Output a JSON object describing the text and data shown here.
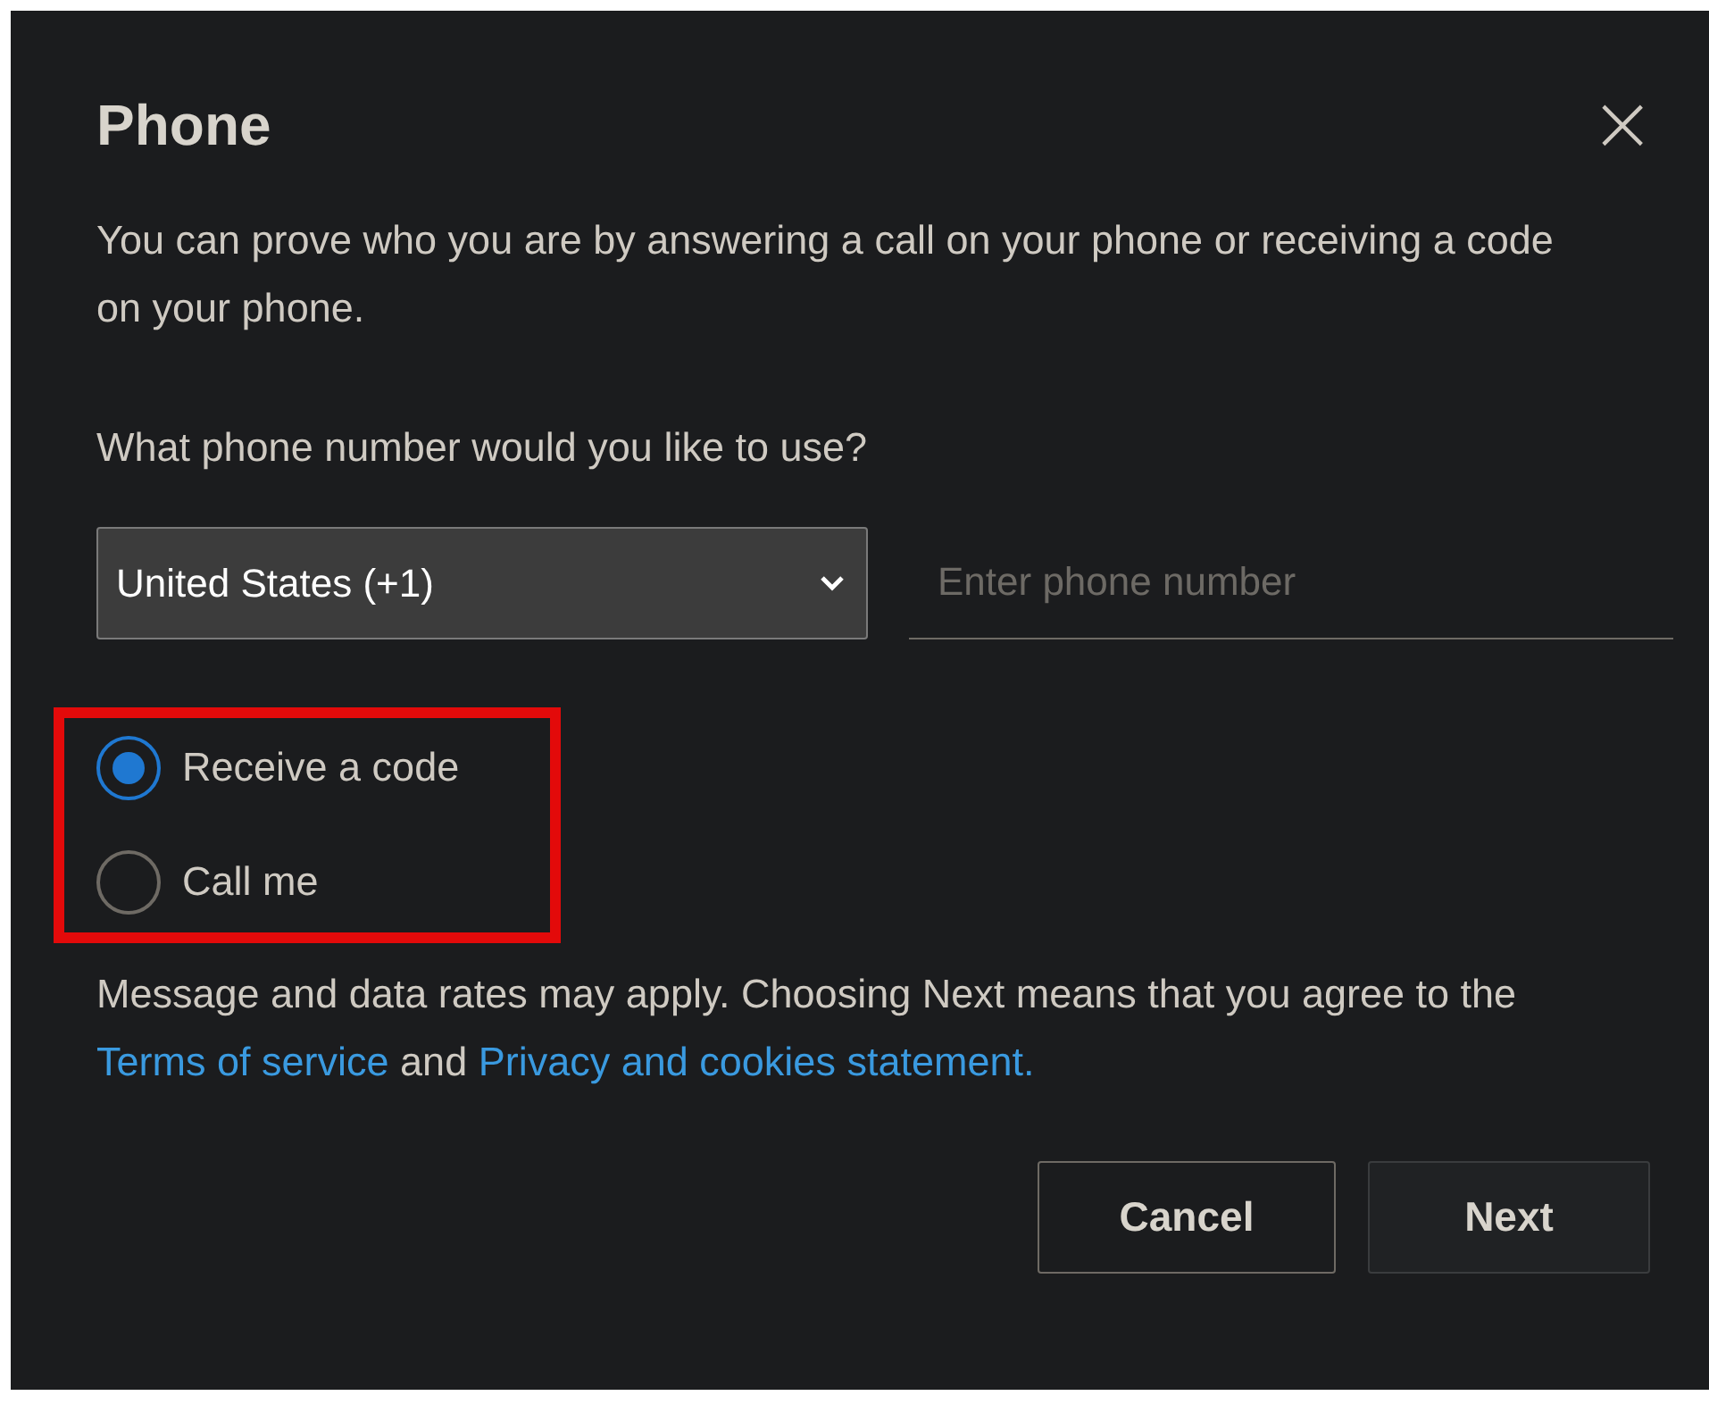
{
  "dialog": {
    "title": "Phone",
    "close": "×"
  },
  "intro": "You can prove who you are by answering a call on your phone or receiving a code on your phone.",
  "question": "What phone number would you like to use?",
  "country_select": {
    "value": "United States (+1)"
  },
  "phone_field": {
    "placeholder": "Enter phone number"
  },
  "methods": [
    {
      "label": "Receive a code",
      "selected": true
    },
    {
      "label": "Call me",
      "selected": false
    }
  ],
  "legal": [
    {
      "kind": "text",
      "text": "Message and data rates may apply. Choosing Next means that you agree to the "
    },
    {
      "kind": "link",
      "text": "Terms of service"
    },
    {
      "kind": "text",
      "text": " and "
    },
    {
      "kind": "link",
      "text": "Privacy and cookies statement."
    }
  ],
  "buttons": [
    "Cancel",
    "Next"
  ]
}
